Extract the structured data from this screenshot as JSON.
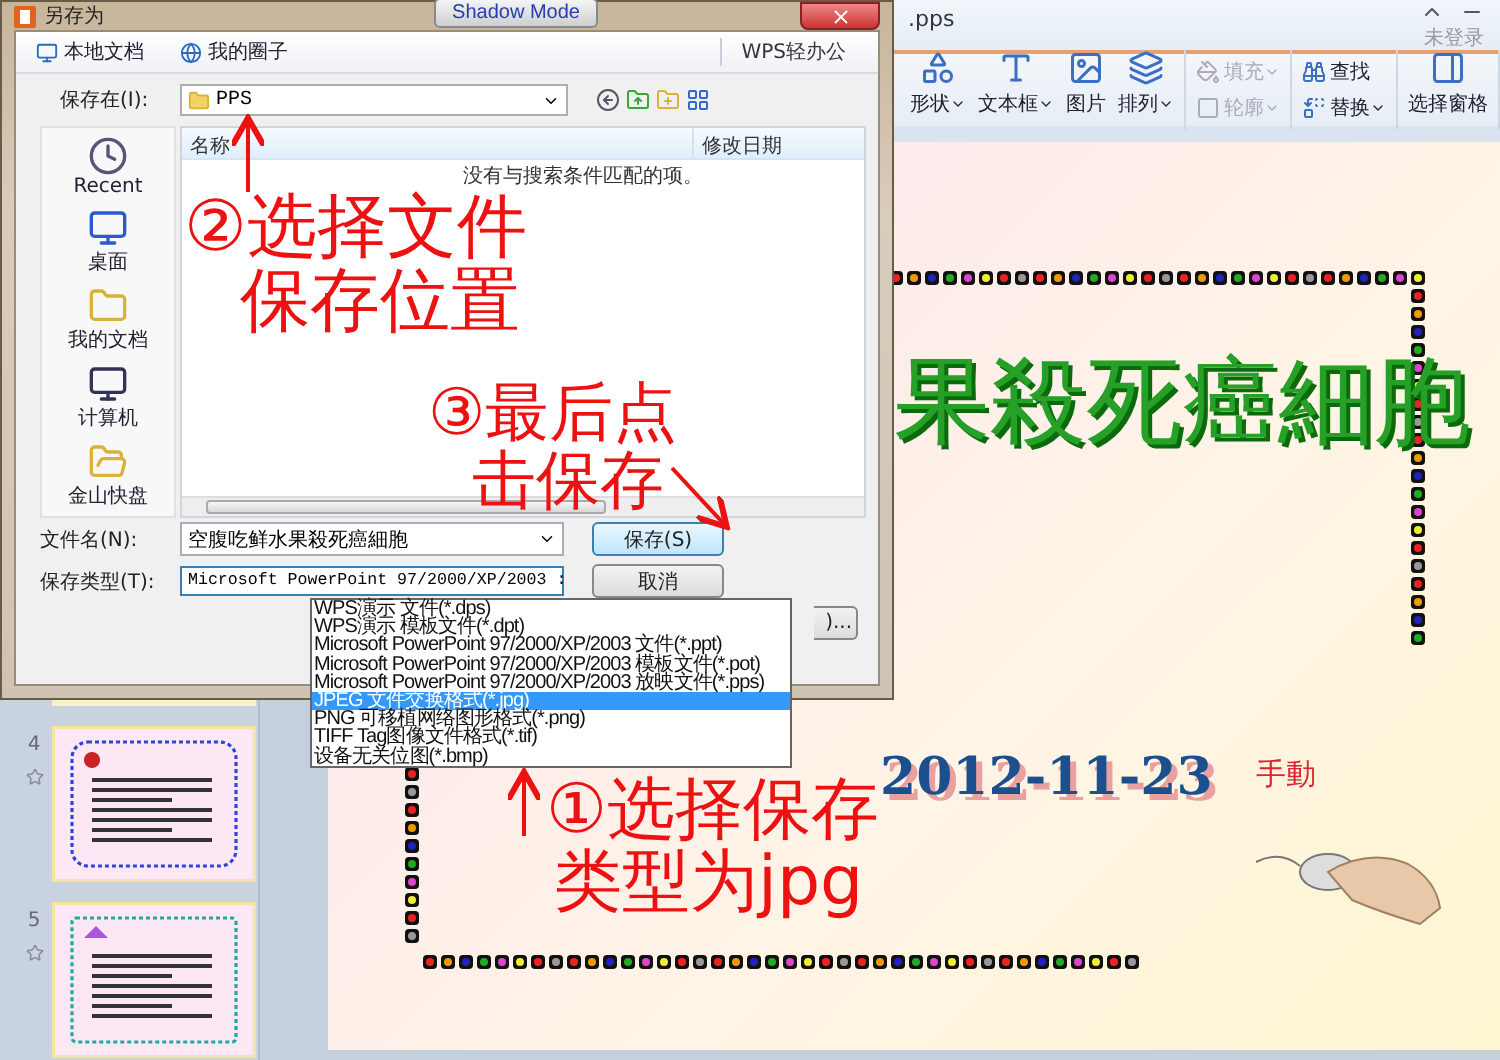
{
  "app": {
    "title": ".pps",
    "account": "未登录",
    "ribbon_groups": [
      {
        "kind": "large",
        "items": [
          {
            "label": "形状",
            "kind": "shapes",
            "caret": true,
            "disabled": false
          },
          {
            "label": "文本框",
            "kind": "textbox",
            "caret": true,
            "disabled": false
          },
          {
            "label": "图片",
            "kind": "image",
            "caret": false,
            "disabled": false
          },
          {
            "label": "排列",
            "kind": "arrange",
            "caret": true,
            "disabled": false
          }
        ]
      },
      {
        "kind": "stack",
        "items": [
          {
            "label": "填充",
            "kind": "fill",
            "caret": true,
            "disabled": true
          },
          {
            "label": "轮廓",
            "kind": "outline",
            "caret": true,
            "disabled": true
          }
        ]
      },
      {
        "kind": "stack",
        "items": [
          {
            "label": "查找",
            "kind": "find",
            "caret": false,
            "disabled": false
          },
          {
            "label": "替换",
            "kind": "replace",
            "caret": true,
            "disabled": false
          }
        ]
      },
      {
        "kind": "large",
        "items": [
          {
            "label": "选择窗格",
            "kind": "pane",
            "caret": false,
            "disabled": false
          }
        ]
      }
    ]
  },
  "slides": [
    {
      "number": "4",
      "kind": "apple"
    },
    {
      "number": "5",
      "kind": "grape"
    }
  ],
  "slide": {
    "title": "果殺死癌細胞",
    "date": "2012-11-23",
    "note": "手動"
  },
  "dialog": {
    "title": "另存为",
    "overlay_button": "Shadow Mode",
    "tabs": [
      {
        "label": "本地文档",
        "kind": "computer"
      },
      {
        "label": "我的圈子",
        "kind": "circle"
      }
    ],
    "cloud_link": "WPS轻办公",
    "location_label": "保存在(I):",
    "location": "PPS",
    "places": [
      {
        "label": "Recent",
        "kind": "recent"
      },
      {
        "label": "桌面",
        "kind": "desktop"
      },
      {
        "label": "我的文档",
        "kind": "documents"
      },
      {
        "label": "计算机",
        "kind": "computer"
      },
      {
        "label": "金山快盘",
        "kind": "cloud"
      }
    ],
    "columns": [
      "名称",
      "修改日期"
    ],
    "empty_message": "没有与搜索条件匹配的项。",
    "filename_label": "文件名(N):",
    "filename": "空腹吃鲜水果殺死癌細胞",
    "type_label": "保存类型(T):",
    "type_value": "Microsoft PowerPoint 97/2000/XP/2003 :",
    "buttons": [
      {
        "label": "保存(S)",
        "kind": "primary"
      },
      {
        "label": "取消",
        "kind": "normal"
      },
      {
        "label": ")...",
        "kind": "partial"
      }
    ],
    "type_options": [
      {
        "label": "WPS演示 文件(*.dps)",
        "selected": false
      },
      {
        "label": "WPS演示 模板文件(*.dpt)",
        "selected": false
      },
      {
        "label": "Microsoft PowerPoint 97/2000/XP/2003 文件(*.ppt)",
        "selected": false
      },
      {
        "label": "Microsoft PowerPoint 97/2000/XP/2003 模板文件(*.pot)",
        "selected": false
      },
      {
        "label": "Microsoft PowerPoint 97/2000/XP/2003 放映文件(*.pps)",
        "selected": false
      },
      {
        "label": "JPEG 文件交换格式(*.jpg)",
        "selected": true
      },
      {
        "label": "PNG 可移植网络图形格式(*.png)",
        "selected": false
      },
      {
        "label": "TIFF Tag图像文件格式(*.tif)",
        "selected": false
      },
      {
        "label": "设备无关位图(*.bmp)",
        "selected": false
      }
    ]
  },
  "annotations": [
    {
      "lines": [
        "②选择文件",
        "保存位置"
      ],
      "kind": "location"
    },
    {
      "lines": [
        "③最后点",
        "击保存"
      ],
      "kind": "save"
    },
    {
      "lines": [
        "①选择保存",
        "类型为jpg"
      ],
      "kind": "type"
    }
  ]
}
